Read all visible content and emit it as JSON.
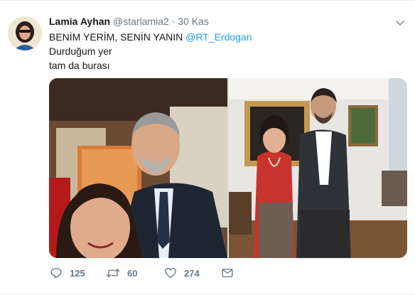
{
  "tweet": {
    "display_name": "Lamia Ayhan",
    "handle": "@starlamia2",
    "separator": "·",
    "time": "30 Kas",
    "text_line1_prefix": "BENİM YERİM, SENİN YANIN ",
    "text_line1_mention": "@RT_Erdogan",
    "text_line2": "Durduğum yer",
    "text_line3": "tam da burası"
  },
  "actions": {
    "reply_count": "125",
    "retweet_count": "60",
    "like_count": "274"
  },
  "icons": {
    "reply": "reply-icon",
    "retweet": "retweet-icon",
    "like": "heart-icon",
    "dm": "envelope-icon",
    "caret": "chevron-down-icon"
  },
  "colors": {
    "mention": "#1da1f2",
    "secondary_text": "#657786",
    "primary_text": "#14171a"
  }
}
